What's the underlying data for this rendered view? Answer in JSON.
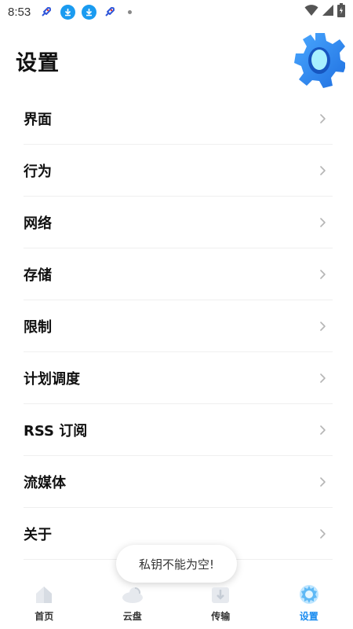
{
  "status_bar": {
    "time": "8:53",
    "icons": [
      "rocket-icon",
      "download-icon",
      "download-icon",
      "rocket-icon",
      "dot-icon"
    ],
    "right_icons": [
      "wifi-icon",
      "signal-icon",
      "battery-icon"
    ]
  },
  "header": {
    "title": "设置",
    "icon": "gear-icon"
  },
  "settings": {
    "items": [
      {
        "label": "界面"
      },
      {
        "label": "行为"
      },
      {
        "label": "网络"
      },
      {
        "label": "存储"
      },
      {
        "label": "限制"
      },
      {
        "label": "计划调度"
      },
      {
        "label": "RSS 订阅"
      },
      {
        "label": "流媒体"
      },
      {
        "label": "关于"
      }
    ]
  },
  "toast": {
    "message": "私钥不能为空!"
  },
  "bottom_nav": {
    "items": [
      {
        "label": "首页",
        "icon": "home-icon"
      },
      {
        "label": "云盘",
        "icon": "cloud-icon"
      },
      {
        "label": "传输",
        "icon": "transfer-icon"
      },
      {
        "label": "设置",
        "icon": "gear-icon",
        "active": true
      }
    ]
  },
  "colors": {
    "accent": "#1a8cf0",
    "text": "#111111",
    "divider": "#efefef"
  }
}
